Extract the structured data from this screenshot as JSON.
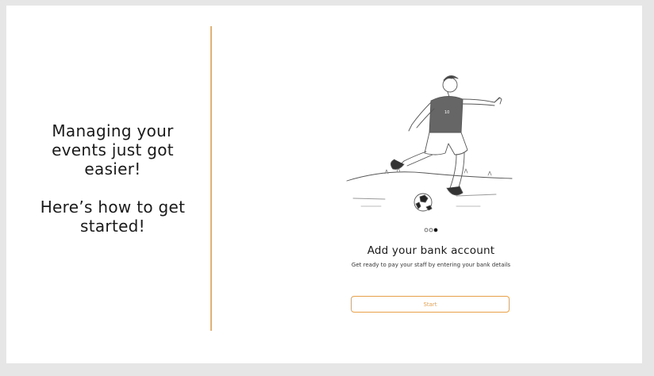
{
  "intro": {
    "line1": "Managing your",
    "line2": "events just got",
    "line3": "easier!",
    "line4": "Here’s how to get",
    "line5": "started!"
  },
  "onboarding": {
    "illustration_icon": "soccer-player-kicking-ball-illustration",
    "steps_total": 3,
    "active_step": 3,
    "title": "Add your bank account",
    "description": "Get ready to pay your staff by entering your bank details",
    "start_label": "Start"
  },
  "colors": {
    "accent": "#e8a04a",
    "divider": "#e8b16a",
    "background": "#e6e6e6",
    "card": "#ffffff"
  }
}
